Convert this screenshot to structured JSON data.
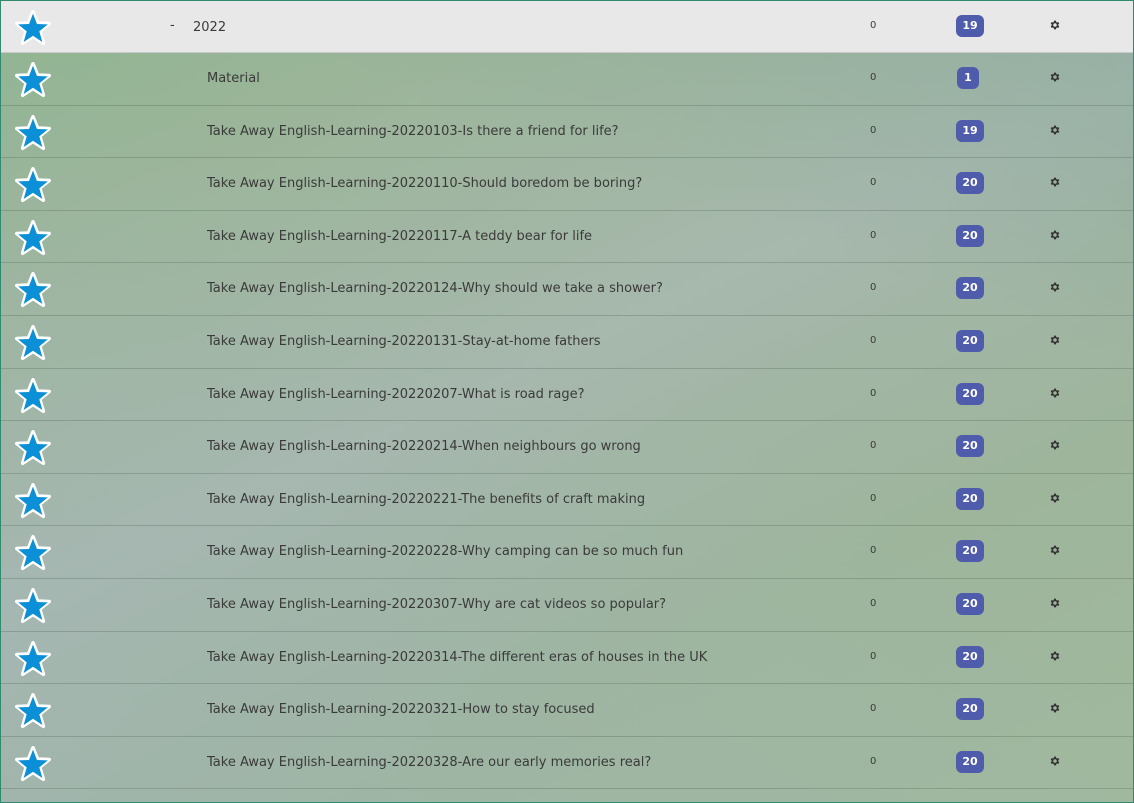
{
  "header": {
    "dash": "-",
    "title": "2022",
    "count": "0",
    "badge": "19"
  },
  "rows": [
    {
      "title": "Material",
      "count": "0",
      "badge": "1"
    },
    {
      "title": "Take Away English-Learning-20220103-Is there a friend for life?",
      "count": "0",
      "badge": "19"
    },
    {
      "title": "Take Away English-Learning-20220110-Should boredom be boring?",
      "count": "0",
      "badge": "20"
    },
    {
      "title": "Take Away English-Learning-20220117-A teddy bear for life",
      "count": "0",
      "badge": "20"
    },
    {
      "title": "Take Away English-Learning-20220124-Why should we take a shower?",
      "count": "0",
      "badge": "20"
    },
    {
      "title": "Take Away English-Learning-20220131-Stay-at-home fathers",
      "count": "0",
      "badge": "20"
    },
    {
      "title": "Take Away English-Learning-20220207-What is road rage?",
      "count": "0",
      "badge": "20"
    },
    {
      "title": "Take Away English-Learning-20220214-When neighbours go wrong",
      "count": "0",
      "badge": "20"
    },
    {
      "title": "Take Away English-Learning-20220221-The benefits of craft making",
      "count": "0",
      "badge": "20"
    },
    {
      "title": "Take Away English-Learning-20220228-Why camping can be so much fun",
      "count": "0",
      "badge": "20"
    },
    {
      "title": "Take Away English-Learning-20220307-Why are cat videos so popular?",
      "count": "0",
      "badge": "20"
    },
    {
      "title": "Take Away English-Learning-20220314-The different eras of houses in the UK",
      "count": "0",
      "badge": "20"
    },
    {
      "title": "Take Away English-Learning-20220321-How to stay focused",
      "count": "0",
      "badge": "20"
    },
    {
      "title": "Take Away English-Learning-20220328-Are our early memories real?",
      "count": "0",
      "badge": "20"
    }
  ],
  "icons": {
    "star": "star-icon",
    "gear": "gear-icon"
  },
  "colors": {
    "star": "#0b8fd6",
    "badge": "#4f5bab",
    "header_bg": "#e8e8e8",
    "frame_border": "#2f8a6f"
  }
}
